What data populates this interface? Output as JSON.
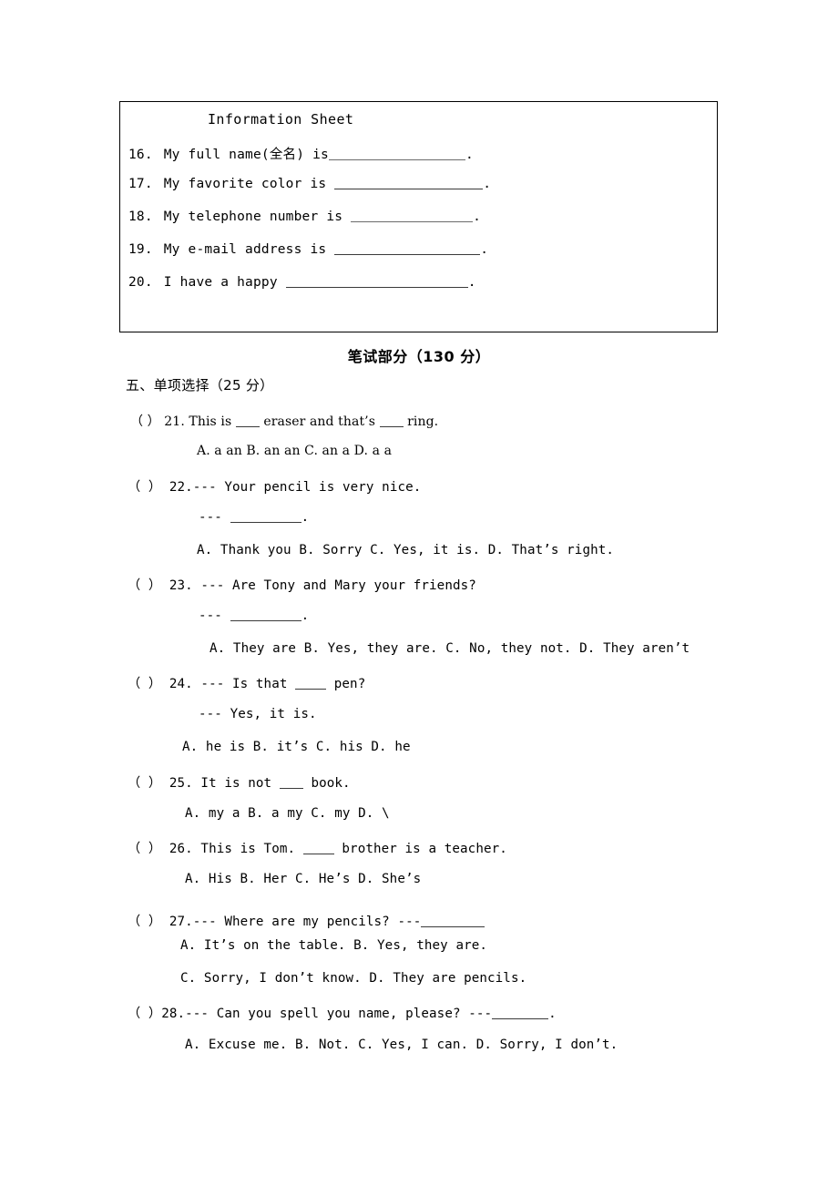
{
  "info_box": {
    "title": "Information Sheet",
    "items": [
      {
        "num": "16.",
        "before": "My full name(全名) is",
        "blank_width": 150,
        "after": "."
      },
      {
        "num": "17.",
        "before": "My favorite color is ",
        "blank_width": 163,
        "after": "."
      },
      {
        "num": "18.",
        "before": "My telephone number is ",
        "blank_width": 134,
        "after": "."
      },
      {
        "num": "19.",
        "before": "My e-mail address is ",
        "blank_width": 160,
        "after": "."
      },
      {
        "num": "20.",
        "before": "I have a happy ",
        "blank_width": 200,
        "after": "."
      }
    ]
  },
  "headings": {
    "exam_part": "笔试部分（130 分）",
    "section_five": "五、单项选择（25 分）"
  },
  "questions": [
    {
      "id": "q21",
      "stem_parts": [
        "（  ） 21.  This is ",
        " eraser and that’s  ",
        "  ring."
      ],
      "options": "A. a  an   B. an  an   C. an  a  D. a  a"
    },
    {
      "id": "q22",
      "stem": "（  ） 22.--- Your pencil is very nice.",
      "reply_prefix": "--- ",
      "reply_suffix": ".",
      "options": "A. Thank you  B. Sorry C. Yes, it is.  D. That’s right."
    },
    {
      "id": "q23",
      "stem": "（  ） 23.  --- Are Tony and Mary your friends?",
      "reply_prefix": "--- ",
      "reply_suffix": ".",
      "options": "A.  They are B. Yes, they are.  C. No, they not. D. They aren’t"
    },
    {
      "id": "q24",
      "stem_parts": [
        "（  ） 24.  --- Is that ",
        " pen?"
      ],
      "reply": "--- Yes, it is.",
      "options": "A. he is     B. it’s   C. his    D. he"
    },
    {
      "id": "q25",
      "stem_parts": [
        "（  ） 25.  It is not ",
        " book."
      ],
      "options": "A. my a    B. a my  C. my   D. \\"
    },
    {
      "id": "q26",
      "stem_parts": [
        "（  ） 26. This is Tom. ",
        " brother is a teacher."
      ],
      "options": "A. His      B. Her    C. He’s   D. She’s"
    },
    {
      "id": "q27",
      "stem_parts": [
        "（  ） 27.--- Where are my pencils?   ---",
        ""
      ],
      "options_a": "A. It’s on the table.   B. Yes, they are.",
      "options_b": "C. Sorry, I don’t know. D. They are pencils."
    },
    {
      "id": "q28",
      "stem_parts": [
        "（  ）28.--- Can you spell you name, please?  ---",
        "."
      ],
      "options": "A.  Excuse me.  B. Not.  C. Yes, I can.  D. Sorry, I don’t."
    }
  ]
}
